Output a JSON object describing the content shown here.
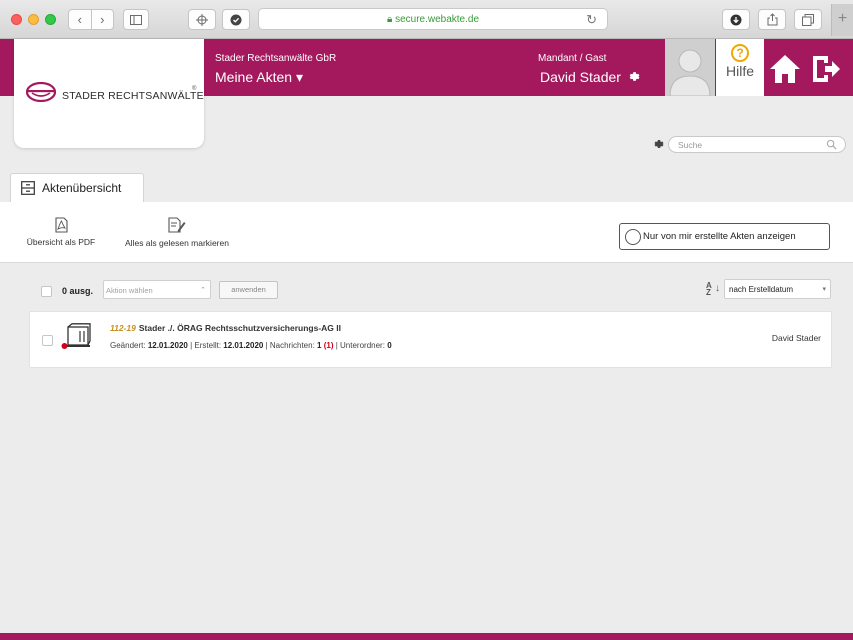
{
  "browser": {
    "url": "secure.webakte.de",
    "new_tab": "+"
  },
  "header": {
    "company": "Stader Rechtsanwälte GbR",
    "my_files": "Meine Akten ▾",
    "role": "Mandant / Gast",
    "user_name": "David Stader",
    "help_label": "Hilfe"
  },
  "logo": {
    "text": "STADER RECHTSANWÄLTE"
  },
  "search": {
    "placeholder": "Suche"
  },
  "tabs": [
    {
      "label": "Aktenübersicht"
    }
  ],
  "toolbar": {
    "pdf_label": "Übersicht als PDF",
    "mark_read_label": "Alles als gelesen markieren",
    "filter_label": "Nur von mir erstellte Akten anzeigen"
  },
  "list_controls": {
    "selected_count": "0 ausg.",
    "action_select": "Aktion wählen",
    "apply_label": "anwenden",
    "sort_select": "nach Erstelldatum"
  },
  "records": [
    {
      "number": "112-19",
      "title": "Stader ./. ÖRAG Rechtsschutzversicherungs-AG II",
      "changed_label": "Geändert:",
      "changed": "12.01.2020",
      "created_label": "Erstellt:",
      "created": "12.01.2020",
      "messages_label": "Nachrichten:",
      "messages": "1",
      "messages_unread": "(1)",
      "subfolders_label": "Unterordner:",
      "subfolders": "0",
      "owner": "David Stader"
    }
  ],
  "colors": {
    "brand": "#a4195e",
    "accent_number": "#c7911f",
    "unread": "#d0021b",
    "help_icon": "#f0a800"
  }
}
